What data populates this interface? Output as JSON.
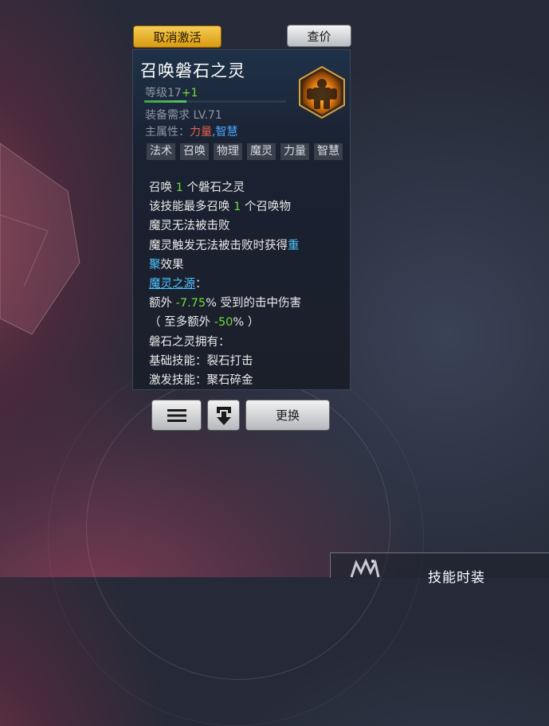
{
  "top_buttons": {
    "cancel_label": "取消激活",
    "price_label": "查价"
  },
  "skill": {
    "name": "召唤磐石之灵",
    "level_prefix": "等级",
    "level": "17",
    "level_bonus": "+1",
    "level_progress": 0.3,
    "requirement": "装备需求 LV.71",
    "main_attr_label": "主属性：",
    "main_attr_1": "力量",
    "main_attr_sep": ",",
    "main_attr_2": "智慧",
    "icon": "rock-spirit-icon",
    "tags": [
      "法术",
      "召唤",
      "物理",
      "魔灵",
      "力量",
      "智慧"
    ]
  },
  "description": {
    "l1_a": "召唤 ",
    "l1_num": "1",
    "l1_b": " 个磐石之灵",
    "l2_a": "该技能最多召唤 ",
    "l2_num": "1",
    "l2_b": " 个召唤物",
    "l3": "魔灵无法被击败",
    "l4_a": "魔灵触发无法被击败时获得",
    "l4_hl1": "重",
    "l4_hl2": "聚",
    "l4_b": "效果",
    "l5_link": "魔灵之源",
    "l5_colon": "：",
    "l6_a": "额外 ",
    "l6_num": "-7.75",
    "l6_b": "% 受到的击中伤害",
    "l7_a": "（ 至多额外 ",
    "l7_num": "-50",
    "l7_b": "% ）",
    "l8": "磐石之灵拥有：",
    "l9": "基础技能：裂石打击",
    "l10": "激发技能：聚石碎金"
  },
  "bottom_buttons": {
    "menu_icon": "menu-icon",
    "download_icon": "equip-down-icon",
    "change_label": "更换"
  },
  "bottom_panel": {
    "label": "技能时装",
    "icon": "skill-fashion-icon"
  },
  "colors": {
    "gold": "#d99a10",
    "green": "#6fdc3a",
    "blue": "#4fc3ff",
    "red_attr": "#e8604a",
    "panel": "#1b1f2a"
  }
}
